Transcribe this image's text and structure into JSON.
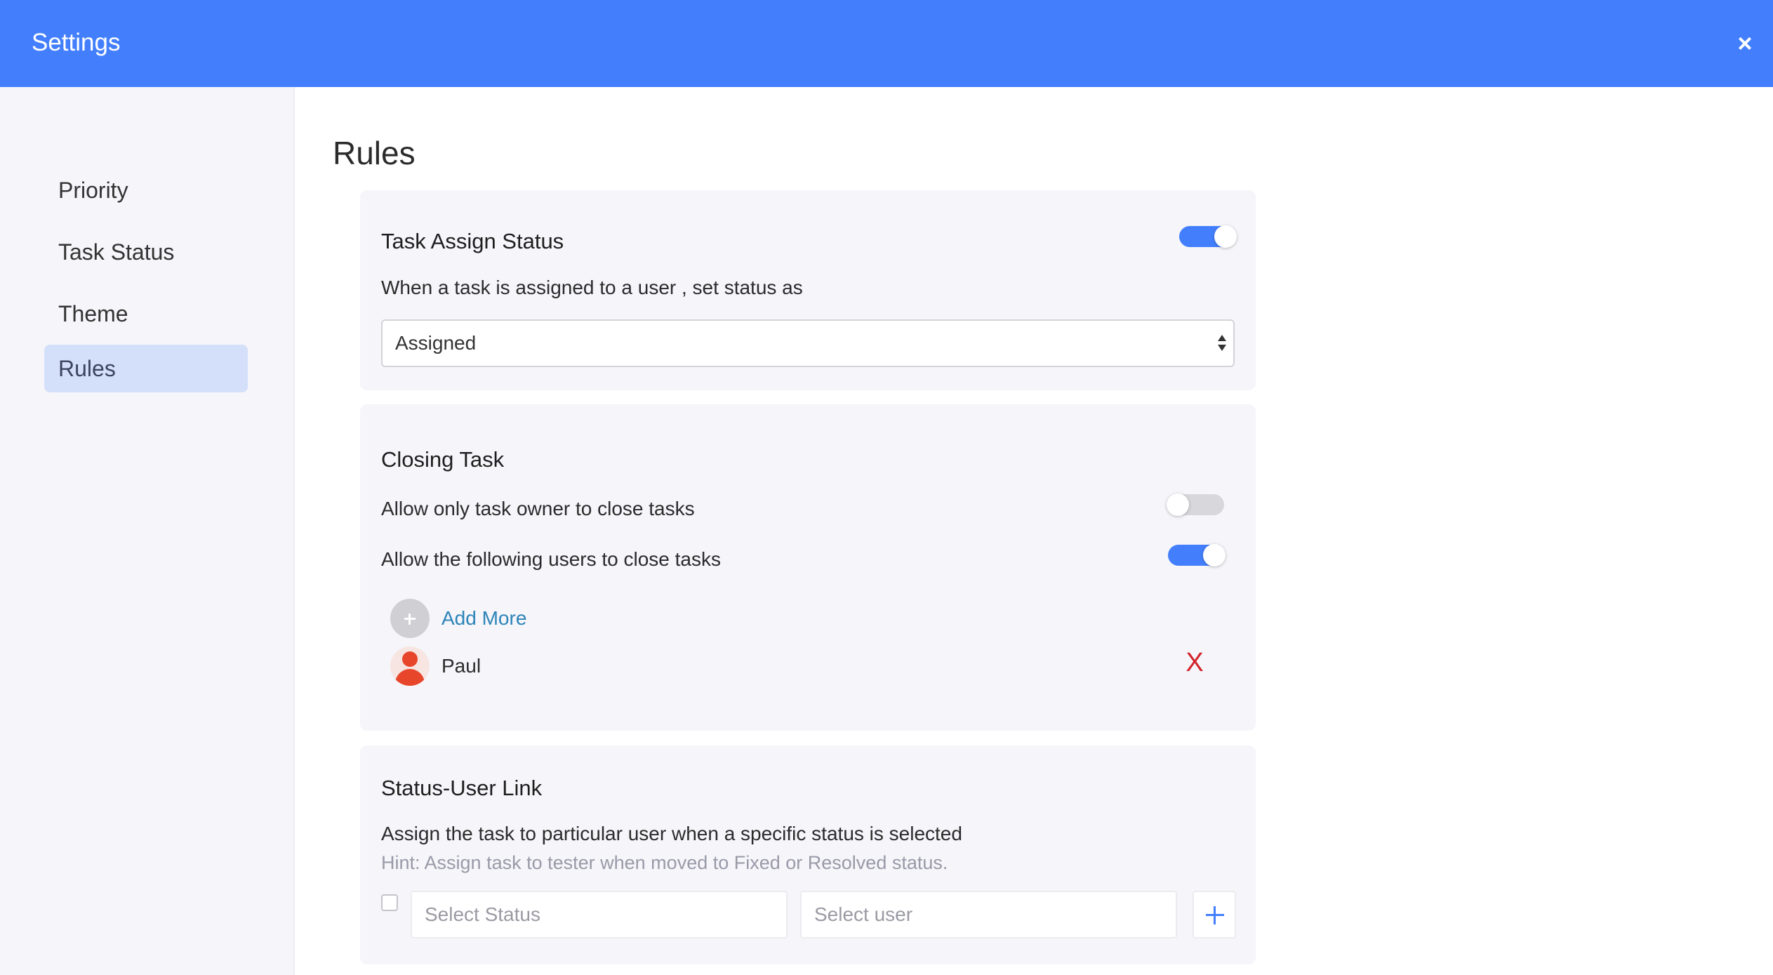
{
  "header": {
    "title": "Settings",
    "close_icon": "×"
  },
  "sidebar": {
    "items": [
      {
        "label": "Priority",
        "active": false
      },
      {
        "label": "Task Status",
        "active": false
      },
      {
        "label": "Theme",
        "active": false
      },
      {
        "label": "Rules",
        "active": true
      }
    ]
  },
  "main": {
    "title": "Rules",
    "task_assign": {
      "title": "Task Assign Status",
      "enabled": true,
      "description": "When a task is assigned to a user , set status as",
      "status_value": "Assigned"
    },
    "closing_task": {
      "title": "Closing Task",
      "owner_only_label": "Allow only task owner to close tasks",
      "owner_only_enabled": false,
      "following_users_label": "Allow the following users to close tasks",
      "following_users_enabled": true,
      "add_more_label": "Add More",
      "users": [
        {
          "name": "Paul",
          "remove_icon": "X"
        }
      ]
    },
    "status_user_link": {
      "title": "Status-User Link",
      "description": "Assign the task to particular user when a specific status is selected",
      "hint": "Hint: Assign task to tester when moved to Fixed or Resolved status.",
      "status_placeholder": "Select Status",
      "user_placeholder": "Select user"
    }
  },
  "colors": {
    "accent": "#437ffd",
    "danger": "#d2232a",
    "link": "#2d84b8"
  }
}
